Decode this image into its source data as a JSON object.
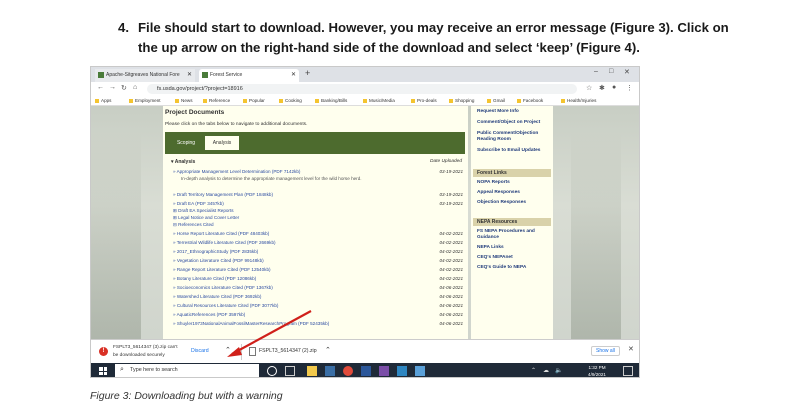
{
  "instruction": {
    "number": "4.",
    "text": "File should start to download.  However, you may receive an error message (Figure 3).  Click on the up arrow on the right-hand side of the download and select ‘keep’ (Figure 4)."
  },
  "browser": {
    "tabs": [
      {
        "label": "Apache-Sitgreaves National Fore"
      },
      {
        "label": "Forest Service"
      }
    ],
    "url": "fs.usda.gov/project/?project=18916",
    "bookmarks": [
      "Apps",
      "Employment",
      "News",
      "Reference",
      "Popular",
      "Cooking",
      "Banking/Bills",
      "Music/Media",
      "Pro-deals",
      "Shopping",
      "Gmail",
      "Facebook",
      "Health/Injuries"
    ]
  },
  "page": {
    "title": "Project Documents",
    "description": "Please click on the tabs below to navigate to additional documents.",
    "tabs": {
      "scoping": "Scoping",
      "analysis": "Analysis"
    },
    "section": "▾ Analysis",
    "date_header": "Date Uploaded",
    "documents": [
      {
        "label": "» Appropriate Management Level Determination (PDF 7142kb)",
        "date": "03-19-2021"
      },
      {
        "label": "» Draft Territory Management Plan (PDF 1848kb)",
        "date": "03-19-2021"
      },
      {
        "label": "» Draft EA (PDF 3457kb)",
        "date": "03-19-2021"
      }
    ],
    "amld_subtext": "In-depth analysis to determine the appropriate management level for the wild horse herd.",
    "groups": [
      "⊞  Draft EA Specialist Reports",
      "⊞  Legal Notice and Cover Letter",
      "⊟  References Cited"
    ],
    "references": [
      {
        "label": "» Horse Report Literature Cited (PDF 48403kb)",
        "date": "04-02-2021"
      },
      {
        "label": "» Terrestrial Wildlife Literature Cited (PDF 2669kb)",
        "date": "04-02-2021"
      },
      {
        "label": "» 2017_EthnographicStudy (PDF 2835kb)",
        "date": "04-02-2021"
      },
      {
        "label": "» Vegetation Literature Cited (PDF 99148kb)",
        "date": "04-02-2021"
      },
      {
        "label": "» Range Report Literature Cited (PDF 12540kb)",
        "date": "04-02-2021"
      },
      {
        "label": "» Botany Literature Cited (PDF 12086kb)",
        "date": "04-02-2021"
      },
      {
        "label": "» Socioeconomics Literature Cited (PDF 1367kb)",
        "date": "04-06-2021"
      },
      {
        "label": "» Watershed Literature Cited (PDF 3692kb)",
        "date": "04-06-2021"
      },
      {
        "label": "» Cultural Resources Literature Cited (PDF 3077kb)",
        "date": "04-06-2021"
      },
      {
        "label": "» AquaticReferences (PDF 3597kb)",
        "date": "04-06-2021"
      },
      {
        "label": "» Shuyler1973NationalAnimalFossilMasterResearchProgram (PDF 52435kb)",
        "date": "04-06-2021"
      }
    ]
  },
  "sidebar": {
    "top_links": [
      "Request More Info",
      "Comment/Object on Project",
      "Public Comment/Objection Reading Room",
      "Subscribe to Email Updates"
    ],
    "forest_links_header": "Forest Links",
    "forest_links": [
      "NOPA Reports",
      "Appeal Responses",
      "Objection Responses"
    ],
    "nepa_header": "NEPA Resources",
    "nepa_links": [
      "FS NEPA Procedures and Guidance",
      "NEPA Links",
      "CEQ's NEPAnet",
      "CEQ's Guide to NEPA"
    ]
  },
  "download_bar": {
    "warning_text": "FSPLT3_5614347 (3).zip can't be downloaded securely",
    "discard": "Discard",
    "second_file": "FSPLT3_5614347 (2).zip",
    "show_all": "Show all"
  },
  "taskbar": {
    "search_placeholder": "Type here to search",
    "time": "1:32 PM",
    "date": "4/9/2021"
  },
  "colors": {
    "tab_green": "#4d6b2e",
    "page_cream": "#ffffee",
    "link_blue": "#2a4aa0",
    "discard_blue": "#1a73e8",
    "arrow_red": "#d0201a",
    "taskbar": "#1f2a38"
  },
  "caption": "Figure 3: Downloading but with a warning"
}
